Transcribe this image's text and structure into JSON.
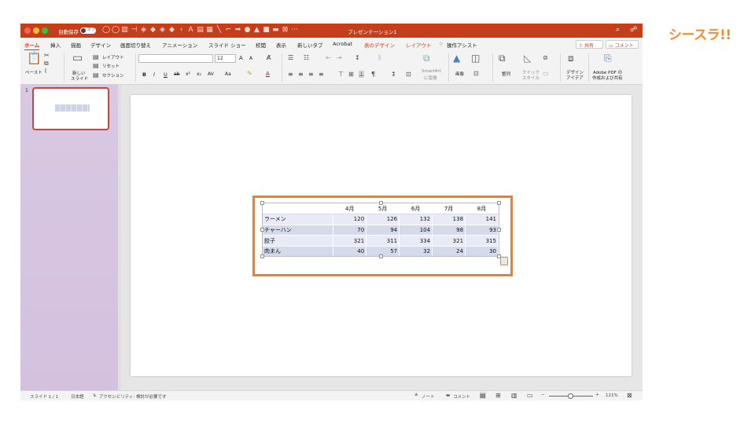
{
  "titlebar": {
    "autosave_label": "自動保存",
    "autosave_state": "オフ",
    "doc_title": "プレゼンテーション1",
    "more": "···",
    "qat_icons": [
      "undo-icon",
      "redo-icon",
      "chart-icon",
      "align-icon",
      "shape-icon",
      "shape-icon",
      "shape-icon",
      "shape-icon",
      "arrow-icon",
      "text-icon",
      "box-icon",
      "box-icon",
      "line-icon",
      "connector-icon",
      "right-arrow-icon",
      "circle-icon",
      "triangle-icon",
      "rect-icon",
      "rect-icon",
      "table-icon"
    ]
  },
  "menu": {
    "tabs": [
      "ホーム",
      "挿入",
      "描画",
      "デザイン",
      "画面切り替え",
      "アニメーション",
      "スライド ショー",
      "校閲",
      "表示",
      "新しいタブ",
      "Acrobat",
      "表のデザイン",
      "レイアウト"
    ],
    "tell_me": "操作アシスト",
    "share": "共有",
    "comment": "コメント"
  },
  "ribbon": {
    "paste": "ペースト",
    "new_slide_1": "新しい",
    "new_slide_2": "スライド",
    "layout": "レイアウト",
    "reset": "リセット",
    "section": "セクション",
    "font_name": "",
    "font_size": "12",
    "grow": "A",
    "shrink": "A",
    "bold": "B",
    "italic": "I",
    "underline": "U",
    "strike": "ab",
    "superscript": "x²",
    "subscript": "x₂",
    "spacing": "AV",
    "case": "Aa",
    "color_a": "A",
    "smartart_1": "SmartArt",
    "smartart_2": "に変換",
    "picture": "画像",
    "arrange": "整列",
    "quick_style_1": "クイック",
    "quick_style_2": "スタイル",
    "design_ideas_1": "デザイン",
    "design_ideas_2": "アイデア",
    "adobe_1": "Adobe PDF の",
    "adobe_2": "作成および共有"
  },
  "slide_panel": {
    "slide_number": "1"
  },
  "table": {
    "headers": [
      "",
      "4月",
      "5月",
      "6月",
      "7月",
      "8月"
    ],
    "rows": [
      {
        "label": "ラーメン",
        "values": [
          "120",
          "126",
          "132",
          "138",
          "141"
        ]
      },
      {
        "label": "チャーハン",
        "values": [
          "70",
          "94",
          "104",
          "98",
          "93"
        ]
      },
      {
        "label": "餃子",
        "values": [
          "321",
          "311",
          "334",
          "321",
          "315"
        ]
      },
      {
        "label": "肉まん",
        "values": [
          "40",
          "57",
          "32",
          "24",
          "30"
        ]
      }
    ]
  },
  "status": {
    "slide_info": "スライド 1 / 1",
    "language": "日本語",
    "accessibility": "アクセシビリティ: 検討が必要です",
    "notes": "ノート",
    "comments": "コメント",
    "zoom": "121%",
    "zoom_minus": "−",
    "zoom_plus": "+"
  },
  "logo": {
    "text": "シースラ!!"
  },
  "colors": {
    "titlebar": "#c43e1c",
    "selection": "#f07f25",
    "logo": "#f58d2f",
    "table_band_dark": "#d5daea",
    "table_band_light": "#e8ebf5"
  }
}
